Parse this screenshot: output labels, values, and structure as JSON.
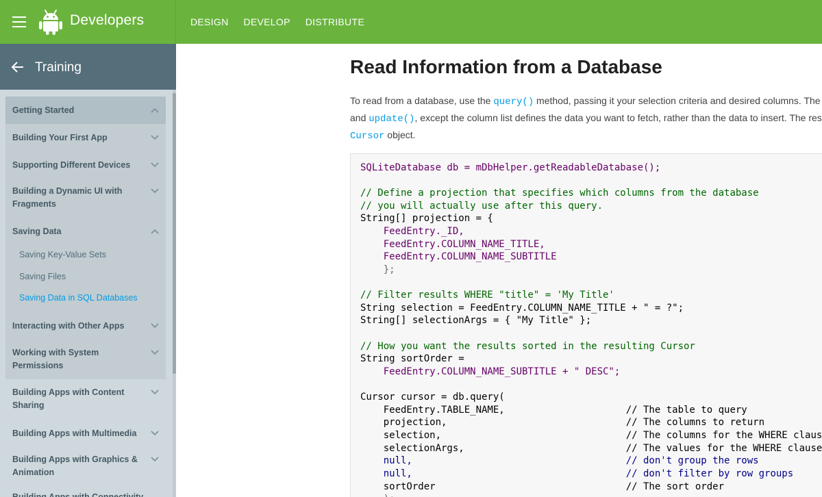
{
  "header": {
    "brand": "Developers",
    "nav": [
      "DESIGN",
      "DEVELOP",
      "DISTRIBUTE"
    ]
  },
  "sidebar": {
    "title": "Training",
    "items": [
      {
        "label": "Getting Started",
        "label2": "",
        "expanded": true
      },
      {
        "label": "Building Your First App",
        "label2": "",
        "expanded": false
      },
      {
        "label": "Supporting Different Devices",
        "label2": "",
        "expanded": false
      },
      {
        "label": "Building a Dynamic UI with",
        "label2": "Fragments",
        "expanded": false
      },
      {
        "label": "Saving Data",
        "label2": "",
        "expanded": true
      },
      {
        "label": "Interacting with Other Apps",
        "label2": "",
        "expanded": false
      },
      {
        "label": "Working with System",
        "label2": "Permissions",
        "expanded": false
      },
      {
        "label": "Building Apps with Content",
        "label2": "Sharing",
        "expanded": false
      },
      {
        "label": "Building Apps with Multimedia",
        "label2": "",
        "expanded": false
      },
      {
        "label": "Building Apps with Graphics &",
        "label2": "Animation",
        "expanded": false
      },
      {
        "label": "Building Apps with Connectivity",
        "label2": "",
        "expanded": false
      }
    ],
    "subitems": [
      {
        "label": "Saving Key-Value Sets",
        "active": false
      },
      {
        "label": "Saving Files",
        "active": false
      },
      {
        "label": "Saving Data in SQL Databases",
        "active": true
      }
    ]
  },
  "content": {
    "title": "Read Information from a Database",
    "para": {
      "line1_a": "To read from a database, use the ",
      "line1_code": "query()",
      "line1_b": " method, passing it your selection criteria and desired columns. The method combines elements of insert()",
      "line2_a": "and ",
      "line2_code": "update()",
      "line2_b": ", except the column list defines the data you want to fetch, rather than the data to insert. The results of the query are returned to you in a",
      "line3_code": "Cursor",
      "line3_b": " object."
    },
    "code": [
      "SQLiteDatabase db = mDbHelper.getReadableDatabase();",
      "",
      "// Define a projection that specifies which columns from the database",
      "// you will actually use after this query.",
      "String[] projection = {",
      "    FeedEntry._ID,",
      "    FeedEntry.COLUMN_NAME_TITLE,",
      "    FeedEntry.COLUMN_NAME_SUBTITLE",
      "    };",
      "",
      "// Filter results WHERE \"title\" = 'My Title'",
      "String selection = FeedEntry.COLUMN_NAME_TITLE + \" = ?\";",
      "String[] selectionArgs = { \"My Title\" };",
      "",
      "// How you want the results sorted in the resulting Cursor",
      "String sortOrder =",
      "    FeedEntry.COLUMN_NAME_SUBTITLE + \" DESC\";",
      "",
      "Cursor cursor = db.query(",
      "    FeedEntry.TABLE_NAME,                     // The table to query",
      "    projection,                               // The columns to return",
      "    selection,                                // The columns for the WHERE clause",
      "    selectionArgs,                            // The values for the WHERE clause",
      "    null,                                     // don't group the rows",
      "    null,                                     // don't filter by row groups",
      "    sortOrder                                 // The sort order",
      "    );"
    ]
  },
  "colors": {
    "topbar": "#6ab43e",
    "sidebar_header": "#546e7a",
    "sidebar_bg": "#cfd8dc",
    "link": "#039be5"
  }
}
